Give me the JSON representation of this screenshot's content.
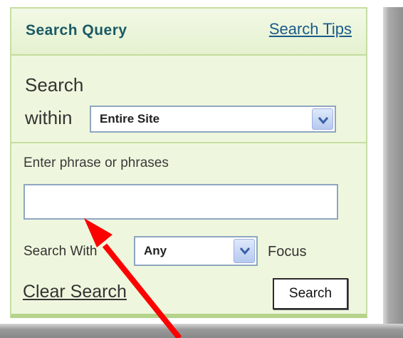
{
  "panel": {
    "title": "Search Query",
    "tips_link": "Search Tips"
  },
  "scope": {
    "label_line1": "Search",
    "label_line2": "within",
    "selected": "Entire Site"
  },
  "phrase": {
    "label": "Enter phrase or phrases",
    "value": ""
  },
  "mode": {
    "label": "Search With",
    "selected": "Any",
    "suffix": "Focus"
  },
  "actions": {
    "clear_label": "Clear Search",
    "search_label": "Search"
  },
  "icons": {
    "dropdown": "chevron-down-icon",
    "annotation": "red-arrow-pointer"
  },
  "colors": {
    "panel_bg": "#eef7dd",
    "panel_border": "#c6dea2",
    "title": "#1a5a66",
    "link": "#1a5a8a",
    "annotation_arrow": "#ff0000"
  }
}
